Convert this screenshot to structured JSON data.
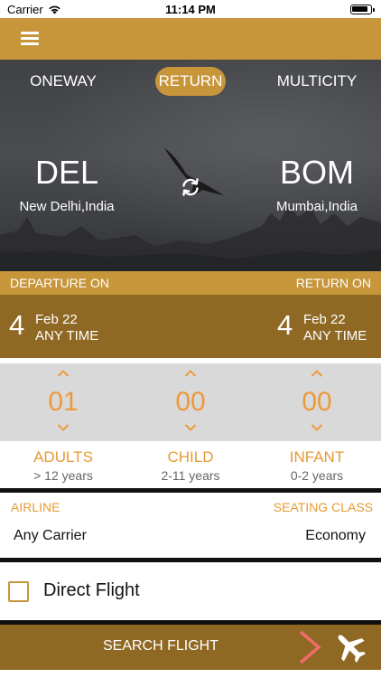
{
  "status_bar": {
    "carrier": "Carrier",
    "time": "11:14 PM"
  },
  "trip_tabs": [
    {
      "label": "ONEWAY",
      "active": false
    },
    {
      "label": "RETURN",
      "active": true
    },
    {
      "label": "MULTICITY",
      "active": false
    }
  ],
  "origin": {
    "code": "DEL",
    "name": "New Delhi,India"
  },
  "destination": {
    "code": "BOM",
    "name": "Mumbai,India"
  },
  "dates": {
    "departure_label": "DEPARTURE ON",
    "return_label": "RETURN ON",
    "departure": {
      "day": "4",
      "month": "Feb 22",
      "time": "ANY TIME"
    },
    "return": {
      "day": "4",
      "month": "Feb 22",
      "time": "ANY TIME"
    }
  },
  "passengers": [
    {
      "count": "01",
      "label": "ADULTS",
      "sub": "> 12 years"
    },
    {
      "count": "00",
      "label": "CHILD",
      "sub": "2-11 years"
    },
    {
      "count": "00",
      "label": "INFANT",
      "sub": "0-2 years"
    }
  ],
  "airline": {
    "label": "AIRLINE",
    "value": "Any Carrier"
  },
  "seating": {
    "label": "SEATING CLASS",
    "value": "Economy"
  },
  "direct_flight": {
    "label": "Direct Flight",
    "checked": false
  },
  "search_button": {
    "label": "SEARCH FLIGHT"
  },
  "colors": {
    "accent": "#c7963b",
    "dark_accent": "#8f6824",
    "counter_orange": "#ee9a3a",
    "arrow_pink": "#f26b6b"
  }
}
